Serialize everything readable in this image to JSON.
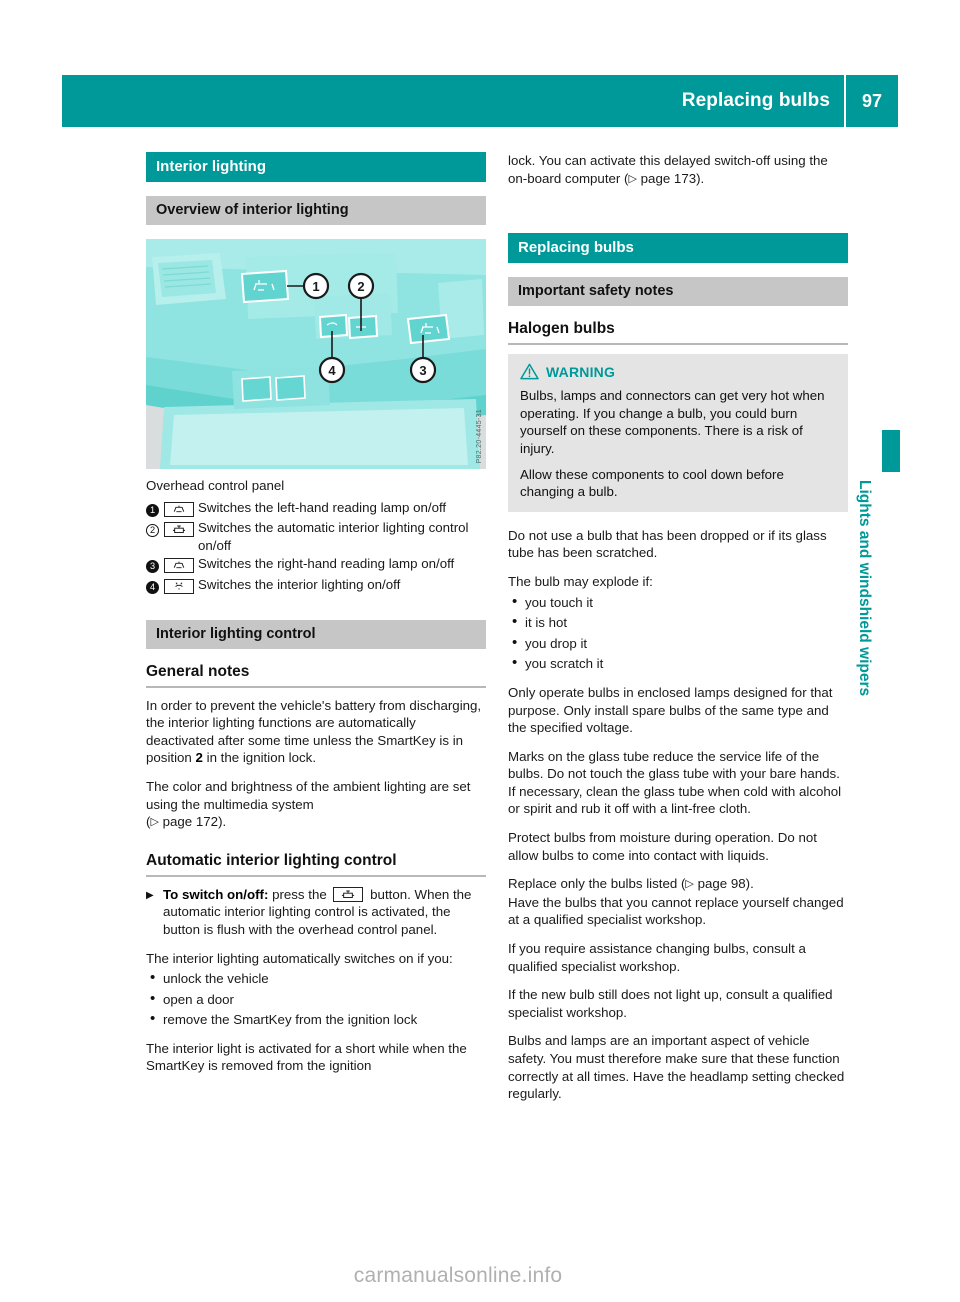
{
  "header": {
    "title": "Replacing bulbs",
    "page_number": "97"
  },
  "side_tab": {
    "label": "Lights and windshield wipers"
  },
  "watermark": "carmanualsonline.info",
  "left_column": {
    "band_interior_lighting": "Interior lighting",
    "band_overview": "Overview of interior lighting",
    "figure": {
      "code": "P82.20-4445-31",
      "callouts": [
        "1",
        "2",
        "3",
        "4"
      ]
    },
    "figure_caption": "Overhead control panel",
    "callout_list": [
      {
        "num": "1",
        "icon": "reading-lamp-icon",
        "text": "Switches the left-hand reading lamp on/off"
      },
      {
        "num": "2",
        "icon": "auto-interior-lighting-icon",
        "text": "Switches the automatic interior lighting control on/off"
      },
      {
        "num": "3",
        "icon": "reading-lamp-icon",
        "text": "Switches the right-hand reading lamp on/off"
      },
      {
        "num": "4",
        "icon": "interior-lighting-icon",
        "text": "Switches the interior lighting on/off"
      }
    ],
    "band_lighting_control": "Interior lighting control",
    "heading_general_notes": "General notes",
    "para_battery_prefix": "In order to prevent the vehicle's battery from discharging, the interior lighting functions are automatically deactivated after some time unless the SmartKey is in position ",
    "para_battery_bold": "2",
    "para_battery_suffix": " in the ignition lock.",
    "para_ambient_line1": "The color and brightness of the ambient lighting are set using the multimedia system",
    "para_ambient_ref": "page 172",
    "heading_auto_control": "Automatic interior lighting control",
    "step_bold": "To switch on/off:",
    "step_text_before_icon": " press the ",
    "step_text_after_icon": " button. When the automatic interior lighting control is activated, the button is flush with the overhead control panel.",
    "para_switches_on": "The interior lighting automatically switches on if you:",
    "bullets": [
      "unlock the vehicle",
      "open a door",
      "remove the SmartKey from the ignition lock"
    ],
    "para_short_while": "The interior light is activated for a short while when the SmartKey is removed from the ignition"
  },
  "right_column": {
    "para_continued_1": "lock. You can activate this delayed switch-off using the on-board computer (",
    "para_continued_ref": "page 173",
    "para_continued_2": ").",
    "band_replacing_bulbs": "Replacing bulbs",
    "band_safety_notes": "Important safety notes",
    "heading_halogen": "Halogen bulbs",
    "warning": {
      "label": "WARNING",
      "icon": "warning-triangle-icon",
      "paragraphs": [
        "Bulbs, lamps and connectors can get very hot when operating. If you change a bulb, you could burn yourself on these components. There is a risk of injury.",
        "Allow these components to cool down before changing a bulb."
      ]
    },
    "para_dropped": "Do not use a bulb that has been dropped or if its glass tube has been scratched.",
    "para_explode": "The bulb may explode if:",
    "bullets": [
      "you touch it",
      "it is hot",
      "you drop it",
      "you scratch it"
    ],
    "para_enclosed": "Only operate bulbs in enclosed lamps designed for that purpose. Only install spare bulbs of the same type and the specified voltage.",
    "para_marks": "Marks on the glass tube reduce the service life of the bulbs. Do not touch the glass tube with your bare hands. If necessary, clean the glass tube when cold with alcohol or spirit and rub it off with a lint-free cloth.",
    "para_moisture": "Protect bulbs from moisture during operation. Do not allow bulbs to come into contact with liquids.",
    "para_replace_prefix": "Replace only the bulbs listed (",
    "para_replace_ref": "page 98",
    "para_replace_suffix": ").",
    "para_replace_line2": "Have the bulbs that you cannot replace yourself changed at a qualified specialist workshop.",
    "para_assistance": "If you require assistance changing bulbs, consult a qualified specialist workshop.",
    "para_new_bulb": "If the new bulb still does not light up, consult a qualified specialist workshop.",
    "para_safety_aspect": "Bulbs and lamps are an important aspect of vehicle safety. You must therefore make sure that these function correctly at all times. Have the headlamp setting checked regularly."
  },
  "colors": {
    "teal": "#009999",
    "band_gray": "#c6c6c6",
    "warning_bg": "#e4e4e4"
  }
}
